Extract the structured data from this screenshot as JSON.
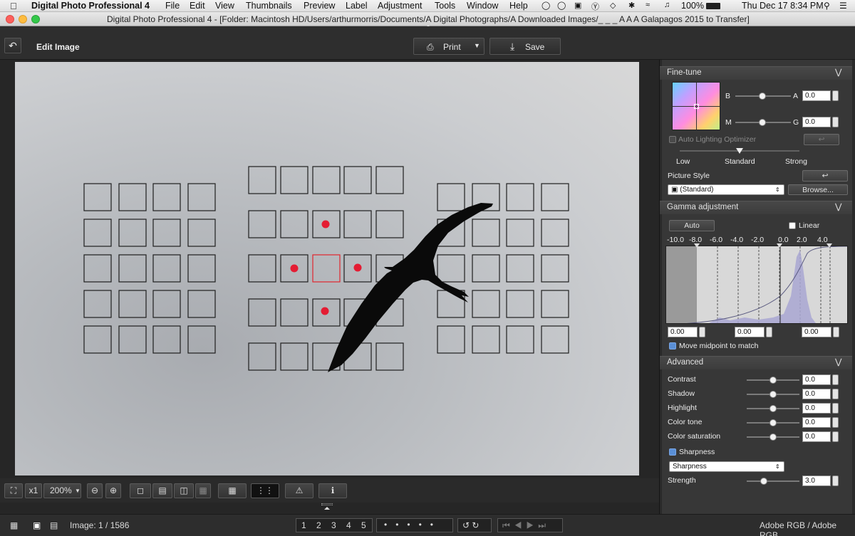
{
  "menubar": {
    "app_name": "Digital Photo Professional 4",
    "items": [
      "File",
      "Edit",
      "View",
      "Thumbnails",
      "Preview",
      "Label",
      "Adjustment",
      "Tools",
      "Window",
      "Help"
    ],
    "battery": "100%",
    "clock": "Thu Dec 17  8:34 PM"
  },
  "titlebar": {
    "title": "Digital Photo Professional 4 - [Folder: Macintosh HD/Users/arthurmorris/Documents/A Digital Photographs/A Downloaded Images/_ _ _ A A A Galapagos 2015 to Transfer]"
  },
  "toolbar": {
    "mode_label": "Edit Image",
    "print_label": "Print",
    "save_label": "Save"
  },
  "view_tools": {
    "zoom_multiplier": "x1",
    "zoom_value": "200%"
  },
  "status": {
    "image_counter": "Image: 1 / 1586",
    "color_space": "Adobe RGB / Adobe RGB",
    "rating_stars": [
      "1",
      "2",
      "3",
      "4",
      "5"
    ]
  },
  "fine_tune": {
    "header": "Fine-tune",
    "label_b": "B",
    "label_a": "A",
    "value_a": "0.0",
    "label_m": "M",
    "label_g": "G",
    "value_g": "0.0",
    "alo_label": "Auto Lighting Optimizer",
    "alo_levels": {
      "low": "Low",
      "standard": "Standard",
      "strong": "Strong"
    },
    "alo_level_value": 0.5,
    "picture_style_label": "Picture Style",
    "picture_style_value": "(Standard)",
    "browse_label": "Browse..."
  },
  "gamma": {
    "header": "Gamma adjustment",
    "auto_label": "Auto",
    "linear_label": "Linear",
    "scale": [
      "-10.0",
      "-8.0",
      "-6.0",
      "-4.0",
      "-2.0",
      "0.0",
      "2.0",
      "4.0"
    ],
    "input_left": "0.00",
    "input_mid": "0.00",
    "input_right": "0.00",
    "midpoint_label": "Move midpoint to match"
  },
  "advanced": {
    "header": "Advanced",
    "rows": [
      {
        "label": "Contrast",
        "value": "0.0"
      },
      {
        "label": "Shadow",
        "value": "0.0"
      },
      {
        "label": "Highlight",
        "value": "0.0"
      },
      {
        "label": "Color tone",
        "value": "0.0"
      },
      {
        "label": "Color saturation",
        "value": "0.0"
      }
    ],
    "sharpness_label": "Sharpness",
    "sharpness_mode": "Sharpness",
    "strength_label": "Strength",
    "strength_value": "3.0"
  },
  "colors": {
    "af_selected": "#e1252d",
    "af_dot": "#e41c33",
    "panel_bg": "#373737"
  }
}
